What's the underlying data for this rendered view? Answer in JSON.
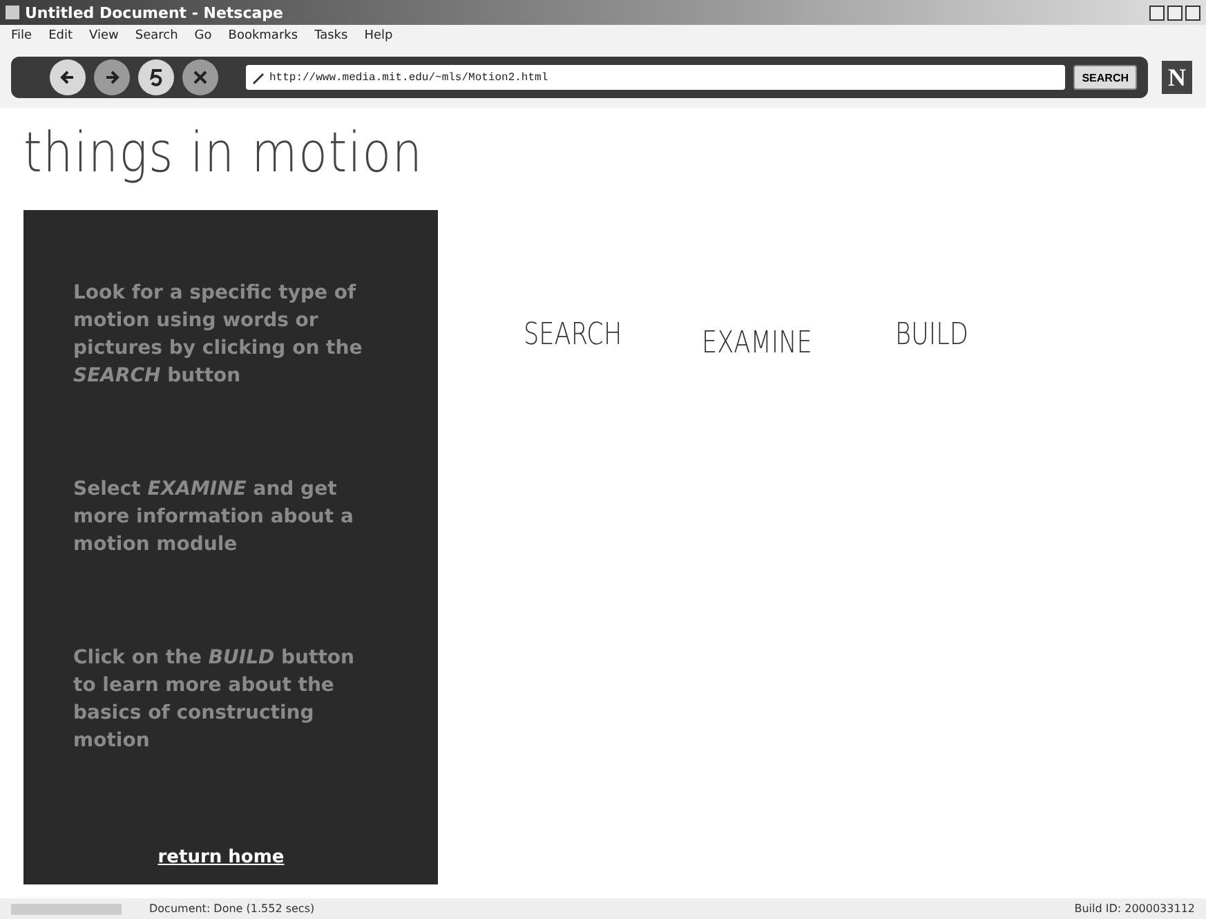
{
  "window": {
    "title": "Untitled Document - Netscape"
  },
  "menu": [
    "File",
    "Edit",
    "View",
    "Search",
    "Go",
    "Bookmarks",
    "Tasks",
    "Help"
  ],
  "toolbar": {
    "url": "http://www.media.mit.edu/~mls/Motion2.html",
    "search_button": "SEARCH",
    "logo": "N"
  },
  "page": {
    "heading": "things in motion",
    "panel": {
      "paragraphs": [
        "Look for a specific type of motion using words or pictures by clicking on the *SEARCH* button",
        "Select *EXAMINE* and get more information about a motion module",
        "Click on the *BUILD* button to learn more about the basics of constructing motion"
      ],
      "link": "return home"
    },
    "nav": [
      "SEARCH",
      "EXAMINE",
      "BUILD"
    ]
  },
  "status_bar": {
    "message": "Document: Done (1.552 secs)",
    "build": "Build ID: 2000033112"
  }
}
